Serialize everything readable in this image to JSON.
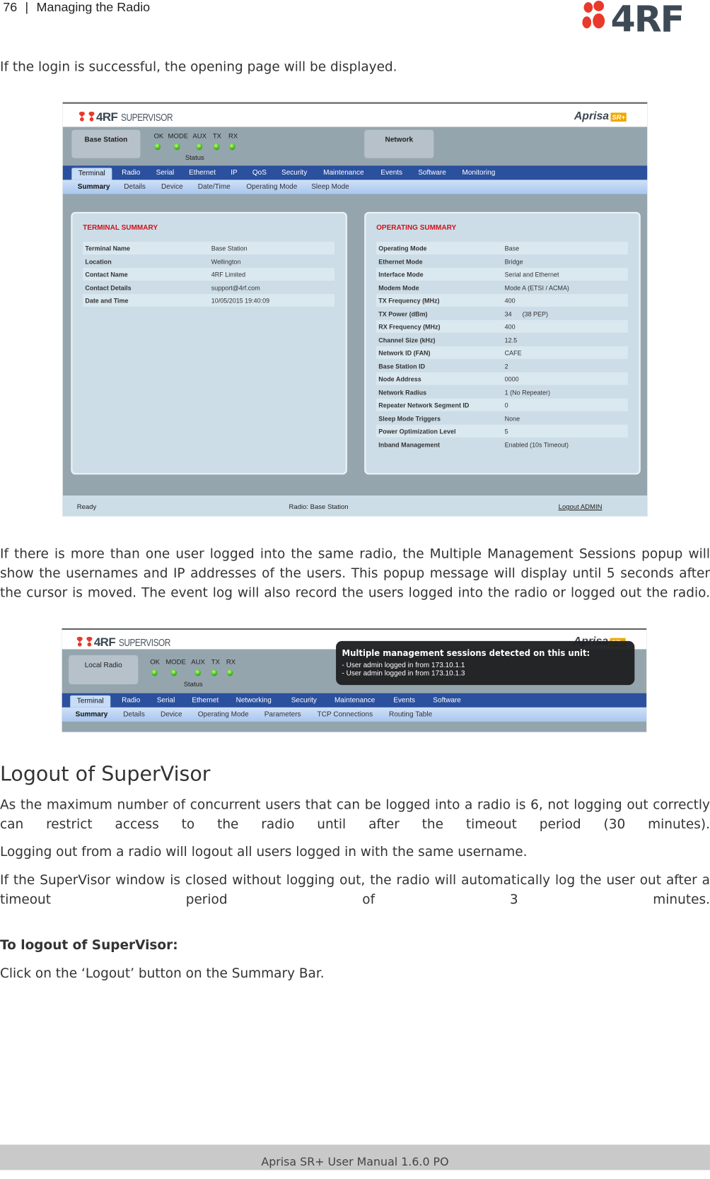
{
  "header": {
    "page_number": "76",
    "separator": "|",
    "section": "Managing the Radio",
    "logo_text": "4RF"
  },
  "paragraphs": {
    "p1": "If the login is successful, the opening page will be displayed.",
    "p2": "If there is more than one user logged into the same radio, the Multiple Management Sessions popup will show the usernames and IP addresses of the users. This popup message will display until 5 seconds after the cursor is moved. The event log will also record the users logged into the radio or logged out the radio.",
    "heading": "Logout of SuperVisor",
    "p3": "As the maximum number of concurrent users that can be logged into a radio is 6, not logging out correctly can restrict access to the radio until after the timeout period (30 minutes).",
    "p4": "Logging out from a radio will logout all users logged in with the same username.",
    "p5": "If the SuperVisor window is closed without logging out, the radio will automatically log the user out after a timeout period of 3 minutes.",
    "procedure_title": "To logout of SuperVisor:",
    "p6": "Click on the ‘Logout’ button on the Summary Bar."
  },
  "screenshot1": {
    "brand": "4RF",
    "product": "SUPERVISOR",
    "aprisa": "Aprisa",
    "aprisa_badge": "SR+",
    "radio_box": "Base Station",
    "network_box": "Network",
    "leds": [
      "OK",
      "MODE",
      "AUX",
      "TX",
      "RX"
    ],
    "led_color": "#3fb21c",
    "status_label": "Status",
    "tabs": [
      "Terminal",
      "Radio",
      "Serial",
      "Ethernet",
      "IP",
      "QoS",
      "Security",
      "Maintenance",
      "Events",
      "Software",
      "Monitoring"
    ],
    "active_tab": "Terminal",
    "subtabs": [
      "Summary",
      "Details",
      "Device",
      "Date/Time",
      "Operating Mode",
      "Sleep Mode"
    ],
    "active_subtab": "Summary",
    "terminal_summary": {
      "title": "TERMINAL SUMMARY",
      "rows": [
        {
          "k": "Terminal Name",
          "v": "Base Station"
        },
        {
          "k": "Location",
          "v": "Wellington"
        },
        {
          "k": "Contact Name",
          "v": "4RF Limited"
        },
        {
          "k": "Contact Details",
          "v": "support@4rf.com"
        },
        {
          "k": "Date and Time",
          "v": "10/05/2015 19:40:09"
        }
      ]
    },
    "operating_summary": {
      "title": "OPERATING SUMMARY",
      "rows": [
        {
          "k": "Operating Mode",
          "v": "Base"
        },
        {
          "k": "Ethernet Mode",
          "v": "Bridge"
        },
        {
          "k": "Interface Mode",
          "v": "Serial and Ethernet"
        },
        {
          "k": "Modem Mode",
          "v": "Mode A (ETSI / ACMA)"
        },
        {
          "k": "TX Frequency (MHz)",
          "v": "400"
        },
        {
          "k": "TX Power (dBm)",
          "v": "34      (38 PEP)"
        },
        {
          "k": "RX Frequency (MHz)",
          "v": "400"
        },
        {
          "k": "Channel Size (kHz)",
          "v": "12.5"
        },
        {
          "k": "Network ID (FAN)",
          "v": "CAFE"
        },
        {
          "k": "Base Station ID",
          "v": "2"
        },
        {
          "k": "Node Address",
          "v": "0000"
        },
        {
          "k": "Network Radius",
          "v": "1 (No Repeater)"
        },
        {
          "k": "Repeater Network Segment ID",
          "v": "0"
        },
        {
          "k": "Sleep Mode Triggers",
          "v": "None"
        },
        {
          "k": "Power Optimization Level",
          "v": "5"
        },
        {
          "k": "Inband Management",
          "v": "Enabled (10s Timeout)"
        }
      ]
    },
    "statusbar": {
      "left": "Ready",
      "center": "Radio: Base Station",
      "logout": "Logout ADMIN"
    }
  },
  "screenshot2": {
    "brand": "4RF",
    "product": "SUPERVISOR",
    "aprisa": "Aprisa",
    "aprisa_badge": "SR+",
    "radio_box": "Local Radio",
    "leds": [
      "OK",
      "MODE",
      "AUX",
      "TX",
      "RX"
    ],
    "status_label": "Status",
    "tabs": [
      "Terminal",
      "Radio",
      "Serial",
      "Ethernet",
      "Networking",
      "Security",
      "Maintenance",
      "Events",
      "Software"
    ],
    "subtabs": [
      "Summary",
      "Details",
      "Device",
      "Operating Mode",
      "Parameters",
      "TCP Connections",
      "Routing Table"
    ],
    "popup": {
      "title": "Multiple management sessions detected on this unit:",
      "lines": [
        "-  User admin logged in from 173.10.1.1",
        "-  User admin logged in from 173.10.1.3"
      ]
    }
  },
  "footer": {
    "text": "Aprisa SR+ User Manual 1.6.0 PO"
  }
}
